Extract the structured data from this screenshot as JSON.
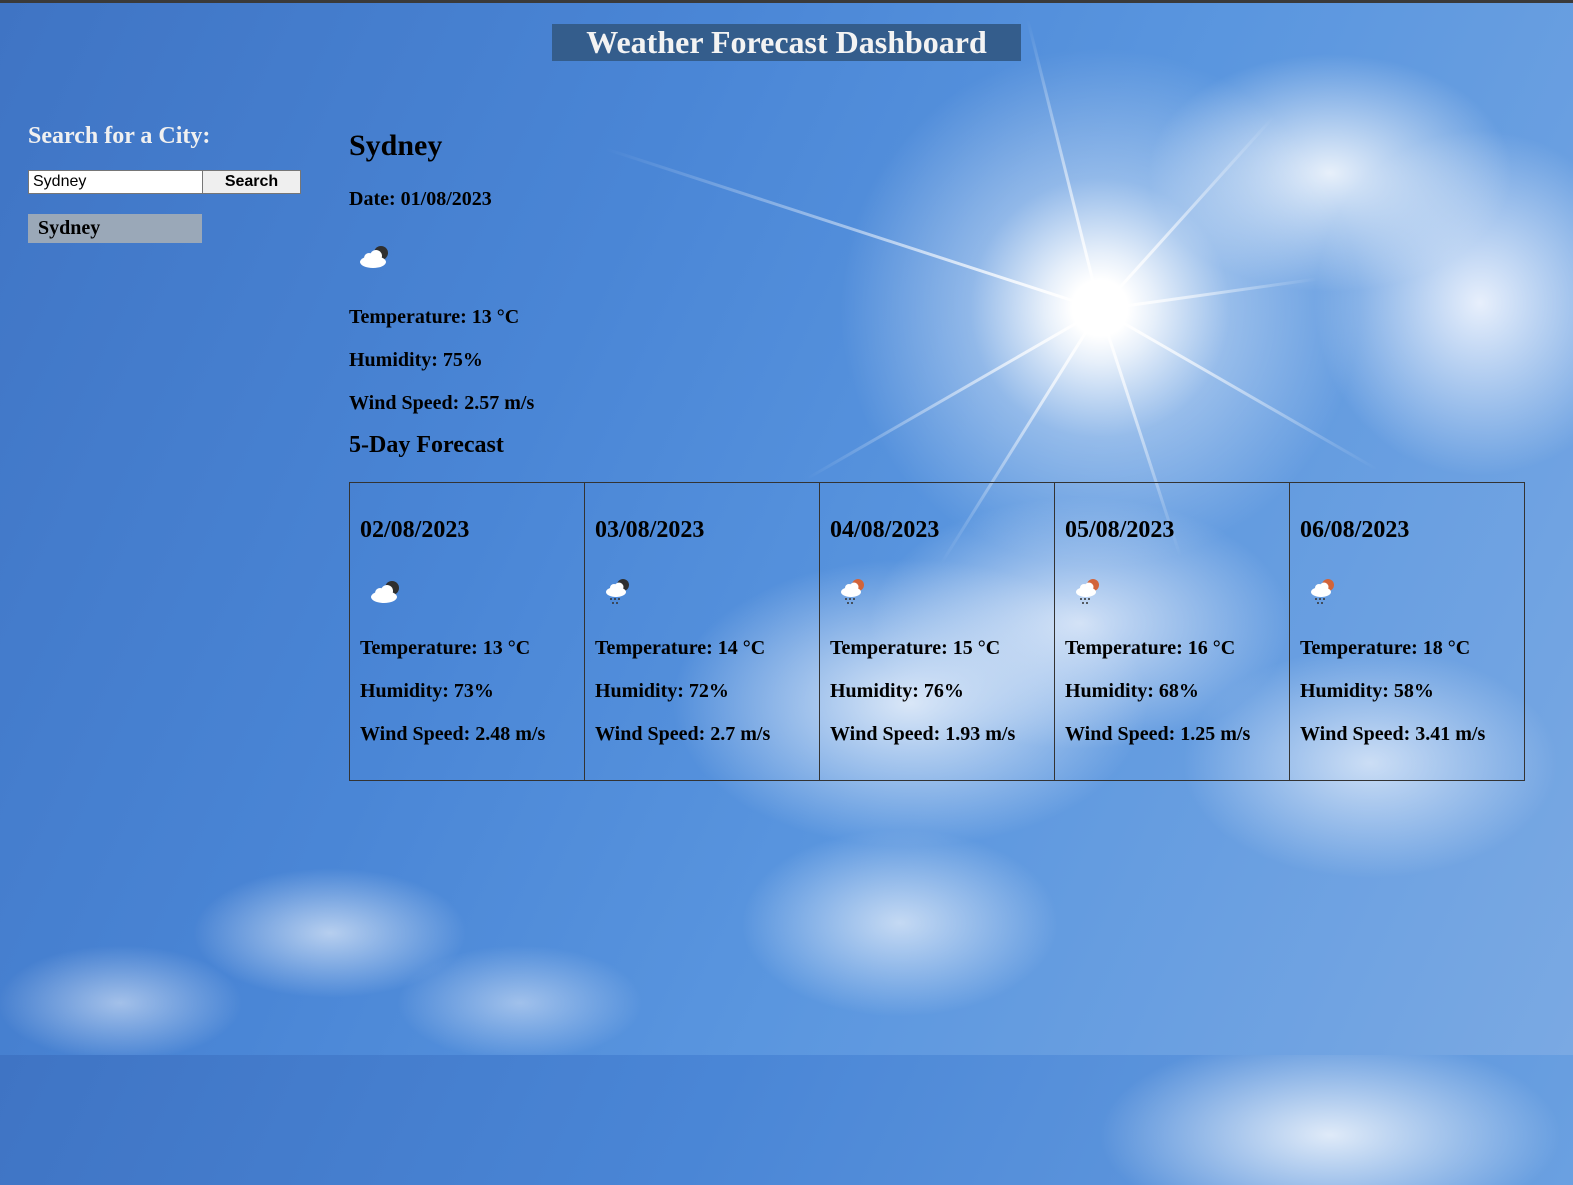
{
  "header": {
    "title": "Weather Forecast Dashboard"
  },
  "sidebar": {
    "search_label": "Search for a City:",
    "search_value": "Sydney",
    "search_button": "Search",
    "history": [
      "Sydney"
    ]
  },
  "current": {
    "city": "Sydney",
    "date": "Date: 01/08/2023",
    "icon": "cloud-moon-icon",
    "temperature": "Temperature: 13 °C",
    "humidity": "Humidity: 75%",
    "wind": "Wind Speed: 2.57 m/s"
  },
  "forecast": {
    "title": "5-Day Forecast",
    "days": [
      {
        "date": "02/08/2023",
        "icon": "cloud-moon-icon",
        "temperature": "Temperature: 13 °C",
        "humidity": "Humidity: 73%",
        "wind": "Wind Speed: 2.48 m/s"
      },
      {
        "date": "03/08/2023",
        "icon": "cloud-moon-rain-icon",
        "temperature": "Temperature: 14 °C",
        "humidity": "Humidity: 72%",
        "wind": "Wind Speed: 2.7 m/s"
      },
      {
        "date": "04/08/2023",
        "icon": "cloud-sun-rain-icon",
        "temperature": "Temperature: 15 °C",
        "humidity": "Humidity: 76%",
        "wind": "Wind Speed: 1.93 m/s"
      },
      {
        "date": "05/08/2023",
        "icon": "cloud-sun-rain-icon",
        "temperature": "Temperature: 16 °C",
        "humidity": "Humidity: 68%",
        "wind": "Wind Speed: 1.25 m/s"
      },
      {
        "date": "06/08/2023",
        "icon": "cloud-sun-rain-icon",
        "temperature": "Temperature: 18 °C",
        "humidity": "Humidity: 58%",
        "wind": "Wind Speed: 3.41 m/s"
      }
    ]
  },
  "colors": {
    "title_bar": "#345d8c",
    "history_item": "#9aa8b8",
    "sky": "#4a86d4"
  }
}
